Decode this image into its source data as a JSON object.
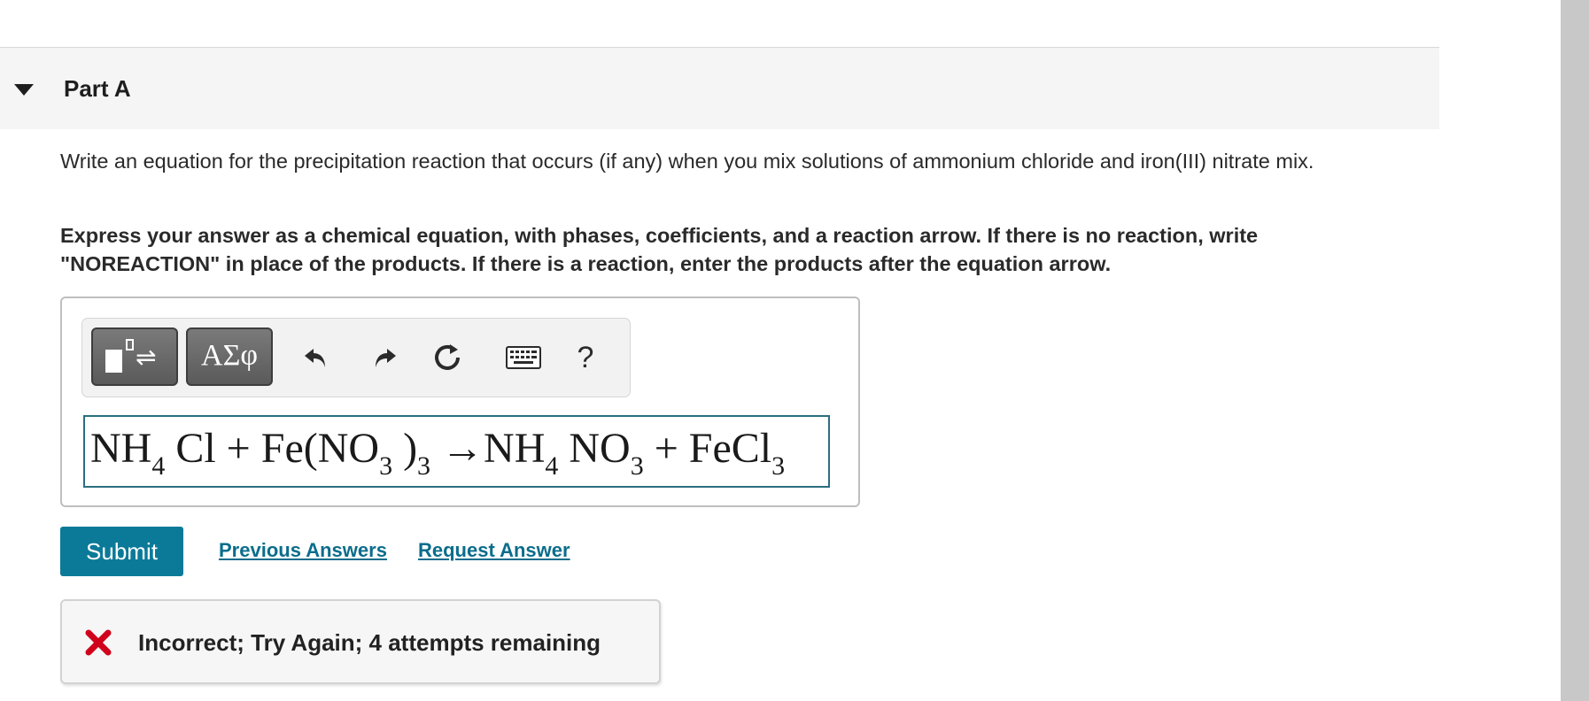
{
  "part": {
    "title": "Part A"
  },
  "question": {
    "text": "Write an equation for the precipitation reaction that occurs (if any) when you mix solutions of ammonium chloride and iron(III) nitrate mix.",
    "instruction": "Express your answer as a chemical equation, with phases, coefficients, and a reaction arrow. If there is no reaction, write \"NOREACTION\" in place of the products. If there is a reaction, enter the products after the equation arrow."
  },
  "toolbar": {
    "greek_label": "ΑΣφ",
    "help_label": "?",
    "icons": [
      "templates-icon",
      "undo-icon",
      "redo-icon",
      "reset-icon",
      "keyboard-icon",
      "help-icon"
    ]
  },
  "equation": {
    "t1": "NH",
    "s1": "4",
    "t2": " Cl + Fe(NO",
    "s2": "3",
    "t3": " )",
    "s3": "3",
    "t4": " →NH",
    "s4": "4",
    "t5": " NO",
    "s5": "3",
    "t6": " + FeCl",
    "s6": "3"
  },
  "actions": {
    "submit_label": "Submit",
    "previous_answers_label": "Previous Answers",
    "request_answer_label": "Request Answer"
  },
  "feedback": {
    "text": "Incorrect; Try Again; 4 attempts remaining",
    "status_color": "#d0021b"
  },
  "colors": {
    "accent": "#0b7a98",
    "link": "#0b6d8c",
    "input_border": "#2a6f7f",
    "toolbar_button": "#636363"
  }
}
